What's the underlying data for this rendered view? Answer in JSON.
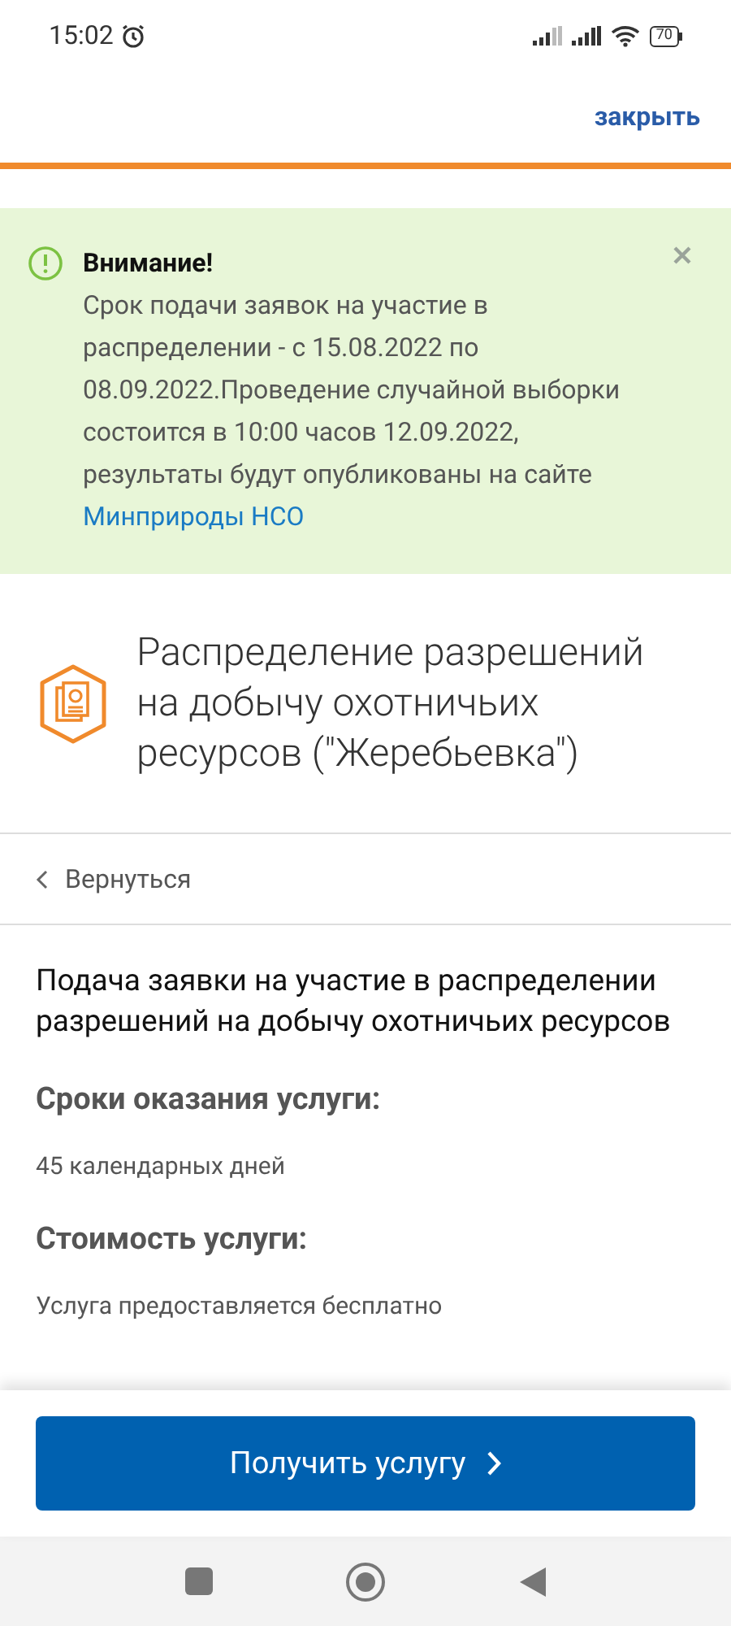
{
  "status_bar": {
    "time": "15:02",
    "battery": "70"
  },
  "header": {
    "close_link": "закрыть"
  },
  "alert": {
    "title": "Внимание!",
    "message": "Срок подачи заявок на участие в распределении - с 15.08.2022 по 08.09.2022.Проведение случайной выборки состоится в 10:00 часов 12.09.2022, результаты будут опубликованы на сайте",
    "link": "Минприроды НСО"
  },
  "service": {
    "title": "Распределение разрешений на добычу охотничьих ресурсов (\"Жеребьевка\")"
  },
  "back_link": "Вернуться",
  "content": {
    "heading": "Подача заявки на участие в распределении разрешений на добычу охотничьих ресурсов",
    "sections": [
      {
        "title": "Сроки оказания услуги:",
        "text": "45 календарных дней"
      },
      {
        "title": "Стоимость услуги:",
        "text": "Услуга предоставляется бесплатно"
      }
    ]
  },
  "action_button": "Получить услугу"
}
